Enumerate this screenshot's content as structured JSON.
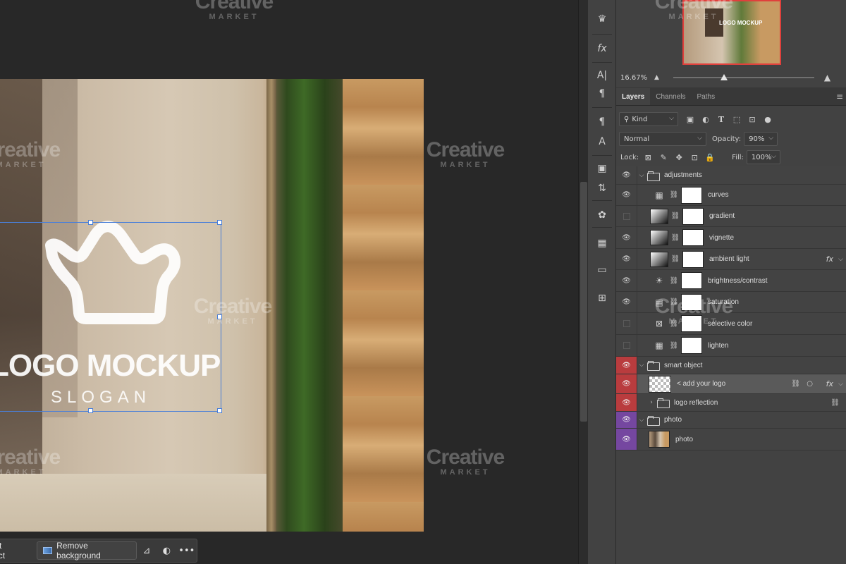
{
  "document": {
    "logo_text": "LOGO MOCKUP",
    "slogan_text": "SLOGAN"
  },
  "watermark": {
    "line1": "Creative",
    "line2": "MARKET"
  },
  "taskbar": {
    "select_subject_label": "Select subject",
    "remove_background_label": "Remove background"
  },
  "navigator": {
    "zoom": "16.67%",
    "thumb_logo": "LOGO MOCKUP",
    "zoom_fraction": 0.36
  },
  "tabs": [
    "Layers",
    "Channels",
    "Paths"
  ],
  "filter": {
    "kind_label": "Kind"
  },
  "blend": {
    "mode": "Normal",
    "opacity_label": "Opacity:",
    "opacity_value": "90%"
  },
  "lock": {
    "lock_label": "Lock:",
    "fill_label": "Fill:",
    "fill_value": "100%"
  },
  "layers": [
    {
      "name": "adjustments",
      "kind": "group",
      "visible": true,
      "color": "none"
    },
    {
      "name": "curves",
      "kind": "adjustment",
      "visible": true
    },
    {
      "name": "gradient",
      "kind": "gradient",
      "visible": false
    },
    {
      "name": "vignette",
      "kind": "gradient",
      "visible": true
    },
    {
      "name": "ambient light",
      "kind": "gradient",
      "visible": true,
      "fx": true
    },
    {
      "name": "brightness/contrast",
      "kind": "adjustment",
      "visible": true
    },
    {
      "name": "saturation",
      "kind": "adjustment",
      "visible": true
    },
    {
      "name": "selective color",
      "kind": "adjustment",
      "visible": false
    },
    {
      "name": "lighten",
      "kind": "adjustment",
      "visible": false
    },
    {
      "name": "smart object",
      "kind": "group",
      "visible": true,
      "color": "red"
    },
    {
      "name": "< add your logo",
      "kind": "smart",
      "visible": true,
      "color": "red",
      "fx": true,
      "selected": true
    },
    {
      "name": "logo reflection",
      "kind": "group-collapsed",
      "visible": true,
      "color": "red"
    },
    {
      "name": "photo",
      "kind": "group",
      "visible": true,
      "color": "purple"
    },
    {
      "name": "photo",
      "kind": "photo",
      "visible": true,
      "color": "purple"
    }
  ],
  "colors": {
    "canvas_bg": "#282828",
    "panel_bg": "#424242",
    "selection_blue": "#4a7fd8",
    "label_red": "#b93c3e",
    "label_purple": "#7547a0",
    "nav_frame": "#e0403c"
  }
}
